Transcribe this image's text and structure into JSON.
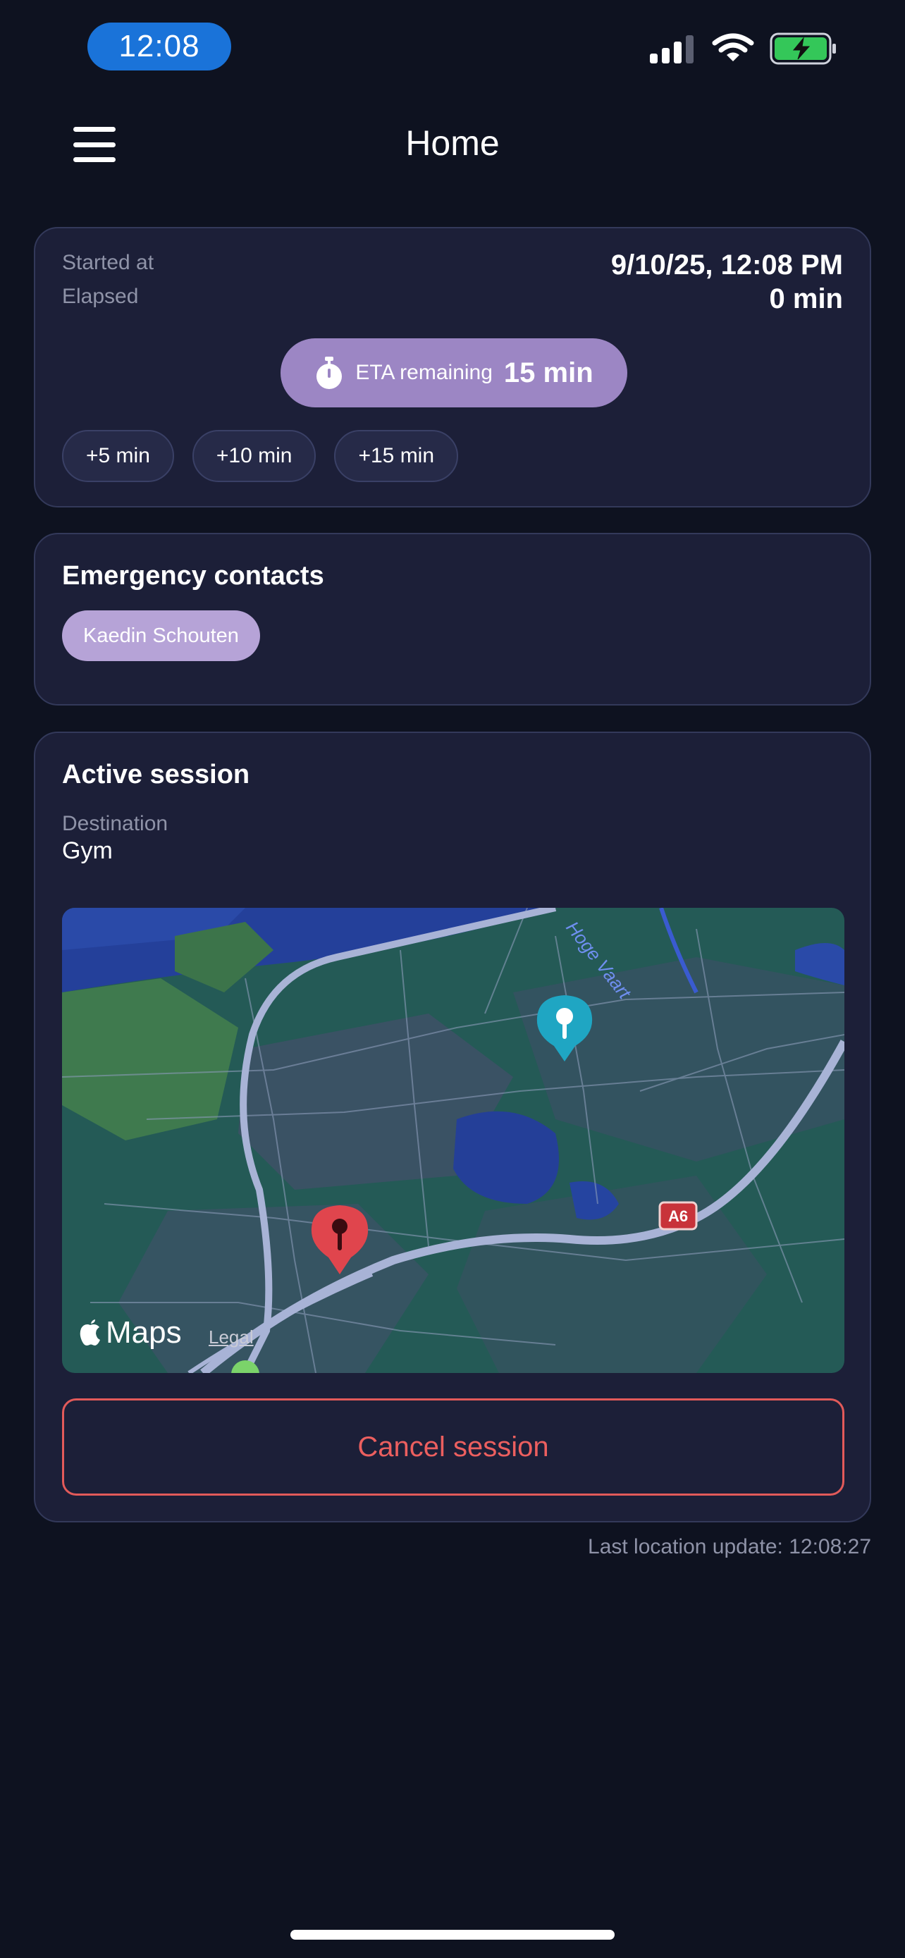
{
  "status_bar": {
    "time": "12:08",
    "icons": [
      "signal-icon",
      "wifi-icon",
      "battery-charging-icon"
    ]
  },
  "header": {
    "title": "Home",
    "menu_icon": "hamburger-menu-icon"
  },
  "timing": {
    "started_label": "Started at",
    "started_value": "9/10/25, 12:08 PM",
    "elapsed_label": "Elapsed",
    "elapsed_value": "0 min",
    "eta_label": "ETA remaining",
    "eta_value": "15 min",
    "eta_icon": "stopwatch-icon",
    "adjust_buttons": [
      "+5 min",
      "+10 min",
      "+15 min"
    ]
  },
  "contacts": {
    "title": "Emergency contacts",
    "items": [
      "Kaedin Schouten"
    ]
  },
  "session": {
    "title": "Active session",
    "destination_label": "Destination",
    "destination_value": "Gym",
    "map": {
      "road_label": "Hoge Vaart",
      "highway_shield": "A6",
      "brand": "Maps",
      "legal": "Legal"
    },
    "cancel_label": "Cancel session"
  },
  "footer": {
    "last_update": "Last location update: 12:08:27"
  },
  "colors": {
    "background": "#0e1220",
    "card": "#1c1f38",
    "accent_purple": "#9c86c4",
    "danger": "#ec5f5f",
    "time_pill": "#1a73d9"
  }
}
